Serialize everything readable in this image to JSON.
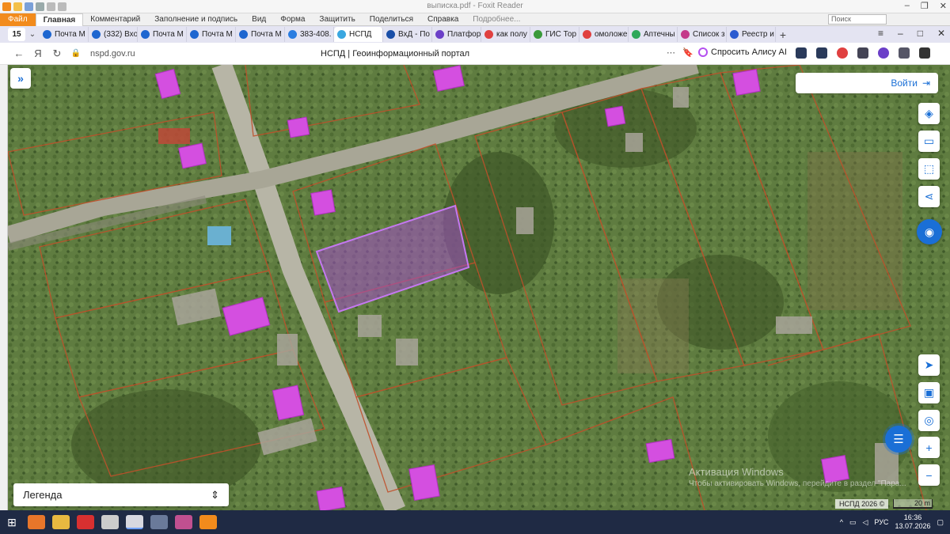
{
  "foxit": {
    "title": "выписка.pdf - Foxit Reader",
    "file_tab": "Файл",
    "ribbon_tabs": [
      "Главная",
      "Комментарий",
      "Заполнение и подпись",
      "Вид",
      "Форма",
      "Защитить",
      "Поделиться",
      "Справка",
      "Подробнее..."
    ],
    "search_placeholder": "Поиск"
  },
  "browser": {
    "tab_count": "15",
    "tabs": [
      {
        "label": "Почта М",
        "color": "#1e66d0"
      },
      {
        "label": "(332) Вхо",
        "color": "#1e66d0"
      },
      {
        "label": "Почта М",
        "color": "#1e66d0"
      },
      {
        "label": "Почта М",
        "color": "#1e66d0"
      },
      {
        "label": "Почта М",
        "color": "#1e66d0"
      },
      {
        "label": "383-408.",
        "color": "#2a7de1"
      },
      {
        "label": "НСПД",
        "color": "#3aa7e0",
        "active": true
      },
      {
        "label": "ВхД - По",
        "color": "#1a4fa8"
      },
      {
        "label": "Платфор",
        "color": "#6b3fc8"
      },
      {
        "label": "как полу",
        "color": "#e04040"
      },
      {
        "label": "ГИС Тор",
        "color": "#3a9a3a"
      },
      {
        "label": "омоложе",
        "color": "#e04040"
      },
      {
        "label": "Аптечны",
        "color": "#2fa85a"
      },
      {
        "label": "Список з",
        "color": "#c43a8a"
      },
      {
        "label": "Реестр и",
        "color": "#2a5ad0"
      }
    ],
    "url": "nspd.gov.ru",
    "page_title": "НСПД | Геоинформационный портал",
    "alisa_label": "Спросить Алису AI"
  },
  "map": {
    "login_label": "Войти",
    "legend_label": "Легенда",
    "watermark_line1": "Активация Windows",
    "watermark_line2": "Чтобы активировать Windows, перейдите в раздел \"Пара...",
    "copyright": "НСПД 2026 ©",
    "scale": "20 m",
    "colors": {
      "building": "#d44fe0",
      "parcel_line": "#c0502a",
      "selected": "#a24ec7",
      "accent": "#1a6fd6"
    }
  },
  "taskbar": {
    "lang": "РУС",
    "time": "16:36",
    "date": "13.07.2026"
  }
}
